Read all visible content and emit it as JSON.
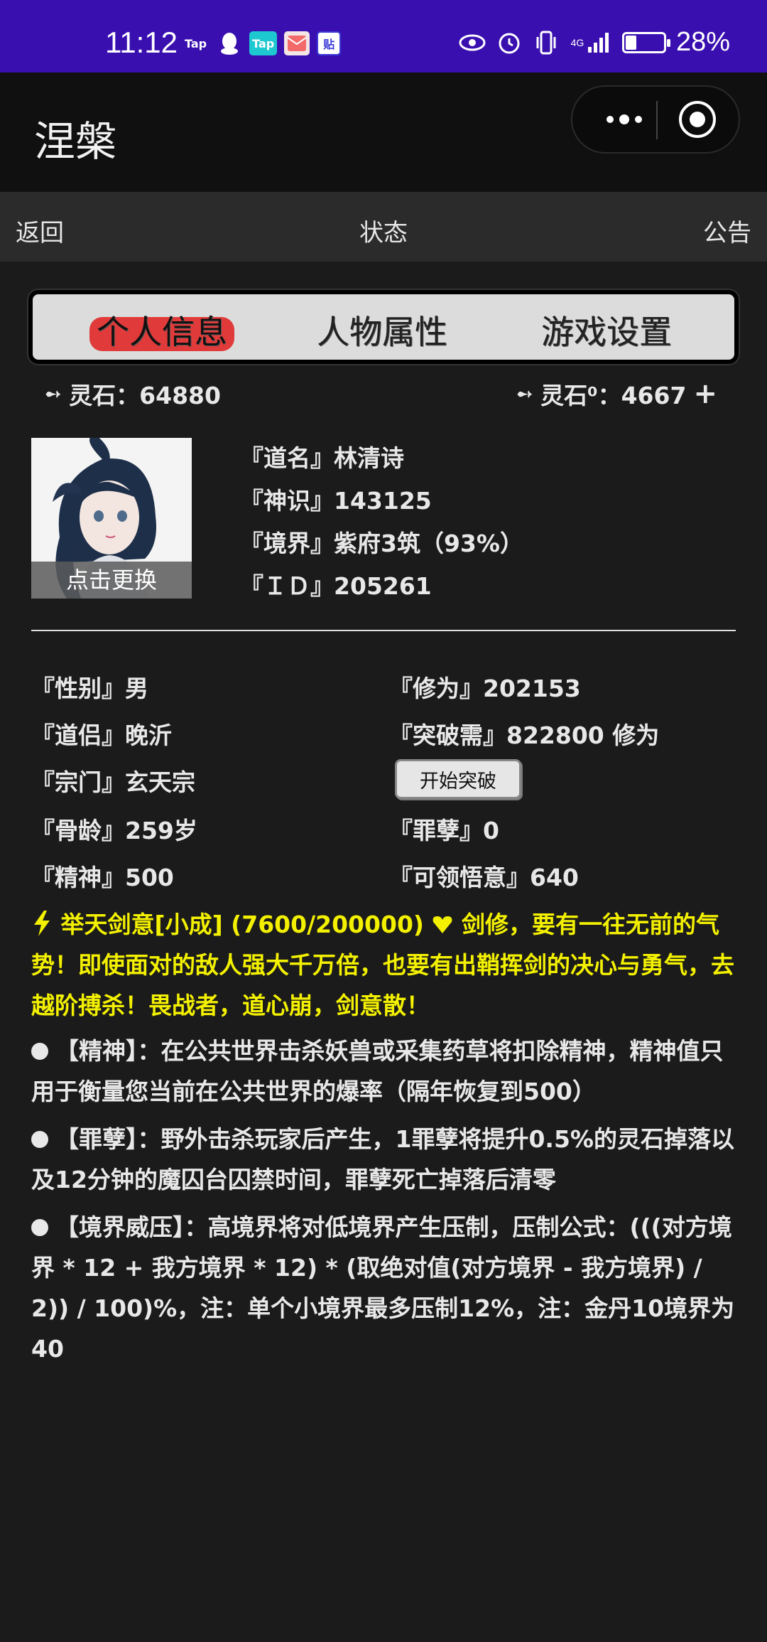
{
  "status_bar": {
    "time": "11:12",
    "app_icons": [
      "Tap",
      "QQ",
      "Tap",
      "Mail",
      "贴"
    ],
    "network": "4G",
    "battery": "28%",
    "battery_level": 0.28
  },
  "app": {
    "title": "涅槃"
  },
  "nav": {
    "back": "返回",
    "title": "状态",
    "notice": "公告"
  },
  "tabs": [
    {
      "label": "个人信息",
      "active": true
    },
    {
      "label": "人物属性",
      "active": false
    },
    {
      "label": "游戏设置",
      "active": false
    }
  ],
  "stones": {
    "left": "灵石：64880",
    "right": "灵石⁰：4667",
    "add": "+"
  },
  "avatar": {
    "change_label": "点击更换"
  },
  "profile": {
    "name": "『道名』林清诗",
    "sense": "『神识』143125",
    "realm": "『境界』紫府3筑（93%）",
    "id": "『ＩＤ』205261"
  },
  "attributes": {
    "gender": "『性别』男",
    "cultivation": "『修为』202153",
    "partner": "『道侣』晚沂",
    "breakthrough": "『突破需』822800 修为",
    "sect": "『宗门』玄天宗",
    "break_button": "开始突破",
    "bone_age": "『骨龄』259岁",
    "sin": "『罪孽』0",
    "spirit": "『精神』500",
    "insight": "『可领悟意』640"
  },
  "skill": {
    "text": "举天剑意[小成] (7600/200000)",
    "desc": "剑修，要有一往无前的气势！即使面对的敌人强大千万倍，也要有出鞘挥剑的决心与勇气，去越阶搏杀！畏战者，道心崩，剑意散！"
  },
  "notes": [
    {
      "text": "【精神】：在公共世界击杀妖兽或采集药草将扣除精神，精神值只用于衡量您当前在公共世界的爆率（隔年恢复到500）"
    },
    {
      "text": "【罪孽】：野外击杀玩家后产生，1罪孽将提升0.5%的灵石掉落以及12分钟的魔囚台囚禁时间，罪孽死亡掉落后清零"
    },
    {
      "text": "【境界威压】：高境界将对低境界产生压制，压制公式：(((对方境界 * 12 + 我方境界 * 12) * (取绝对值(对方境界 - 我方境界) / 2)) / 100)%，注：单个小境界最多压制12%，注：金丹10境界为40"
    }
  ],
  "colors": {
    "status_bar": "#3a0fb0",
    "skill_text": "#f3f000",
    "active_tab": "#e03a3a"
  }
}
